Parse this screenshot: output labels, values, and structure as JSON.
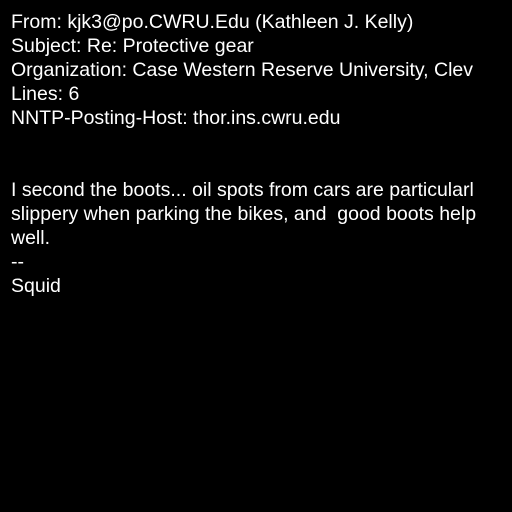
{
  "headers": {
    "from": "From: kjk3@po.CWRU.Edu (Kathleen J. Kelly)",
    "subject": "Subject: Re: Protective gear",
    "organization": "Organization: Case Western Reserve University, Clev",
    "lines": "Lines: 6",
    "nntp_host": "NNTP-Posting-Host: thor.ins.cwru.edu"
  },
  "body": {
    "lines": [
      "I second the boots... oil spots from cars are particularl",
      "slippery when parking the bikes, and  good boots help",
      "well.",
      "--",
      "Squid"
    ]
  }
}
